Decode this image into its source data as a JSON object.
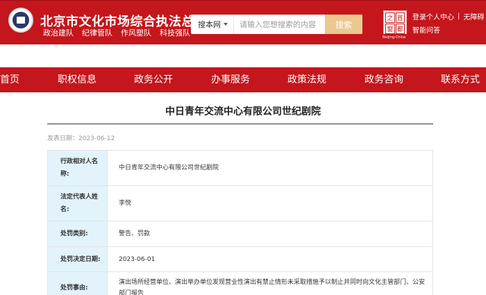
{
  "header": {
    "site_title": "北京市文化市场综合执法总队",
    "slogans": [
      "政治建队",
      "纪律管队",
      "作风塑队",
      "科技强队"
    ],
    "search": {
      "scope": "搜本网",
      "placeholder": "请输入您想搜索的内容",
      "button": "搜索"
    },
    "capital_logo": {
      "chars": [
        "之",
        "首",
        "窗",
        "都"
      ],
      "caption": "Beijing-China"
    },
    "user_links": [
      "登录个人中心",
      "无障碍"
    ],
    "smart_qa": "智能问答"
  },
  "nav": {
    "items": [
      "首页",
      "职权信息",
      "政务公开",
      "办事服务",
      "政策法规",
      "政务咨询",
      "联系方式"
    ]
  },
  "article": {
    "title": "中日青年交流中心有限公司世纪剧院",
    "publish_date": "发表日期：2023-06-12",
    "rows": [
      {
        "label": "行政相对人名称:",
        "value": "中日青年交流中心有限公司世纪剧院"
      },
      {
        "label": "法定代表人姓名:",
        "value": "李悦"
      },
      {
        "label": "处罚类别:",
        "value": "警告、罚款"
      },
      {
        "label": "处罚决定日期:",
        "value": "2023-06-01"
      },
      {
        "label": "处罚事由:",
        "value": "演出场所经营单位、演出举办单位发现营业性演出有禁止情形未采取措施予以制止并同时向文化主管部门、公安部门报告"
      }
    ]
  },
  "colors": {
    "brand_red": "#c4161c",
    "search_button": "#ebc890",
    "label_cell_bg": "#e2f3fb"
  }
}
